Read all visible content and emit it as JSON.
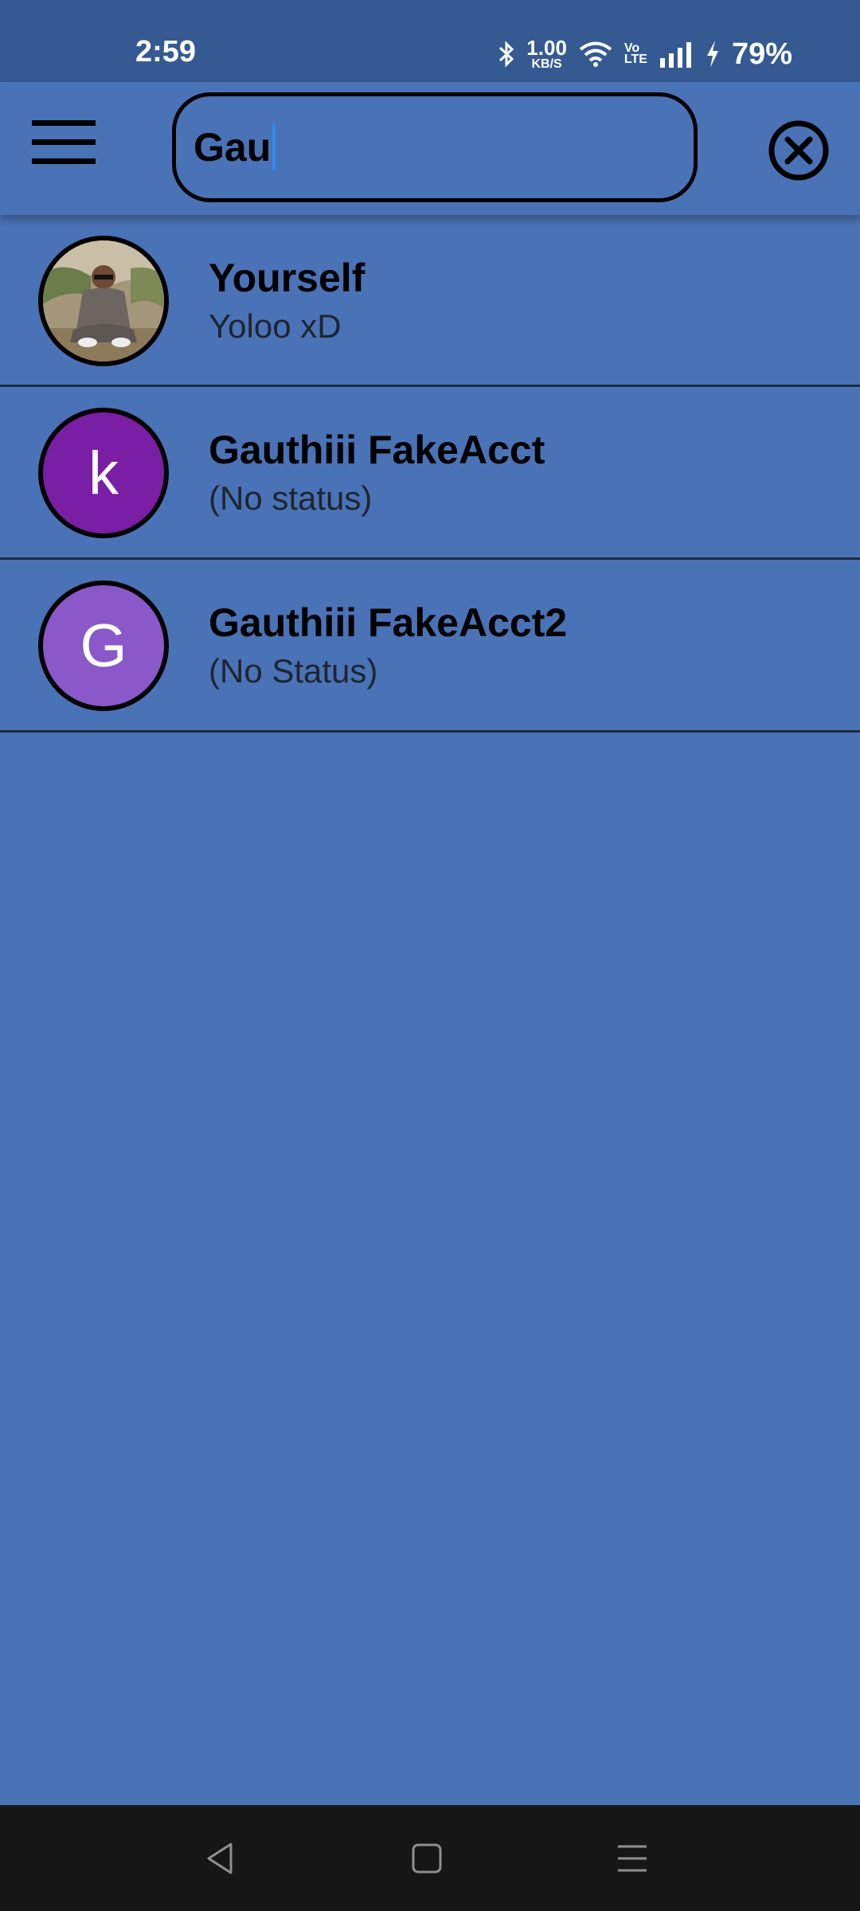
{
  "status_bar": {
    "time": "2:59",
    "net_speed_value": "1.00",
    "net_speed_unit": "KB/S",
    "volte_top": "Vo",
    "volte_bottom": "LTE",
    "battery": "79%",
    "icons": [
      "bluetooth-icon",
      "wifi-icon",
      "signal-icon",
      "charging-icon"
    ]
  },
  "app_bar": {
    "search_value": "Gau",
    "menu_icon": "hamburger-menu-icon",
    "clear_icon": "close-circle-icon"
  },
  "contacts": [
    {
      "name": "Yourself",
      "status": "Yoloo xD",
      "avatar_type": "photo"
    },
    {
      "name": "Gauthiii FakeAcct",
      "status": "(No status)",
      "avatar_letter": "k",
      "avatar_color": "#7a1ea6"
    },
    {
      "name": "Gauthiii FakeAcct2",
      "status": "(No Status)",
      "avatar_letter": "G",
      "avatar_color": "#8a58c8"
    }
  ],
  "nav_bar": {
    "back_icon": "back-triangle-icon",
    "home_icon": "home-square-icon",
    "recents_icon": "recents-menu-icon"
  },
  "colors": {
    "background": "#4a72b6",
    "status_bar": "#355a92",
    "nav_bar": "#161616",
    "caret": "#2f8df0"
  }
}
